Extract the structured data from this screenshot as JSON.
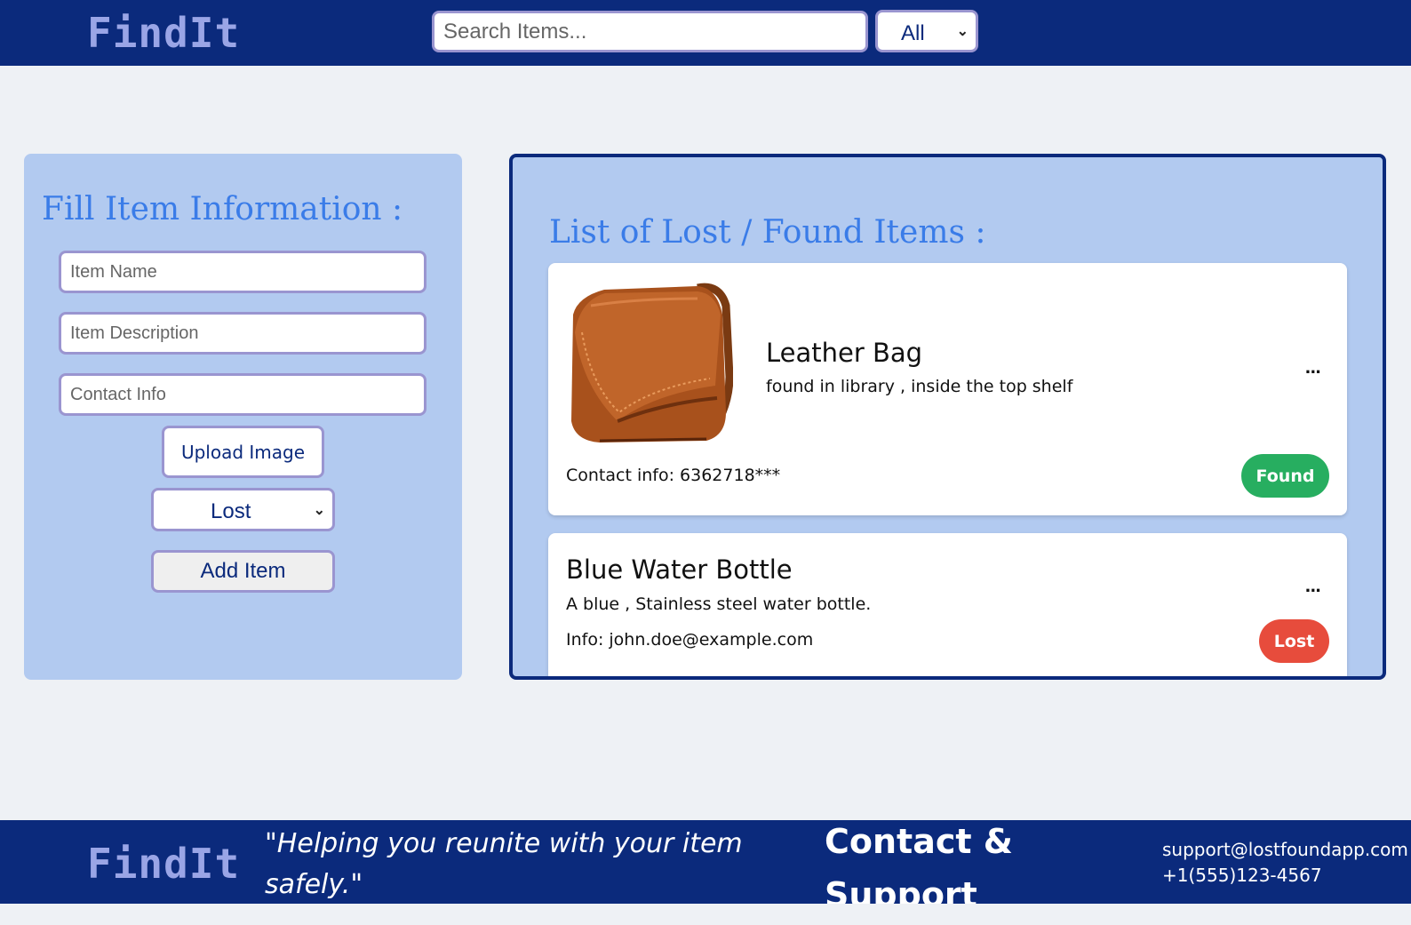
{
  "header": {
    "logo": "FindIt",
    "search_placeholder": "Search Items...",
    "filter_selected": "All"
  },
  "form": {
    "title": "Fill Item Information :",
    "item_name_placeholder": "Item Name",
    "item_description_placeholder": "Item Description",
    "contact_info_placeholder": "Contact Info",
    "upload_label": "Upload Image",
    "status_selected": "Lost",
    "add_label": "Add Item"
  },
  "list": {
    "title": "List of Lost / Found Items :",
    "items": [
      {
        "name": "Leather Bag",
        "description": "found in library , inside the top shelf",
        "contact": "Contact info: 6362718***",
        "status": "Found",
        "status_color": "#27ae60",
        "more": "...",
        "image": "brown-leather-bag"
      },
      {
        "name": "Blue Water Bottle",
        "description": "A blue , Stainless steel water bottle.",
        "contact": "Info: john.doe@example.com",
        "status": "Lost",
        "status_color": "#e74c3c",
        "more": "..."
      }
    ]
  },
  "footer": {
    "logo": "FindIt",
    "tagline": "\"Helping you reunite with your item safely.\"",
    "contact_heading": "Contact & Support",
    "email": "support@lostfoundapp.com",
    "phone": "+1(555)123-4567"
  },
  "colors": {
    "brand_navy": "#0b2a7c",
    "panel_blue": "#b2caf0",
    "title_blue": "#3a7ce8",
    "logo_lavender": "#9aa5e6"
  }
}
